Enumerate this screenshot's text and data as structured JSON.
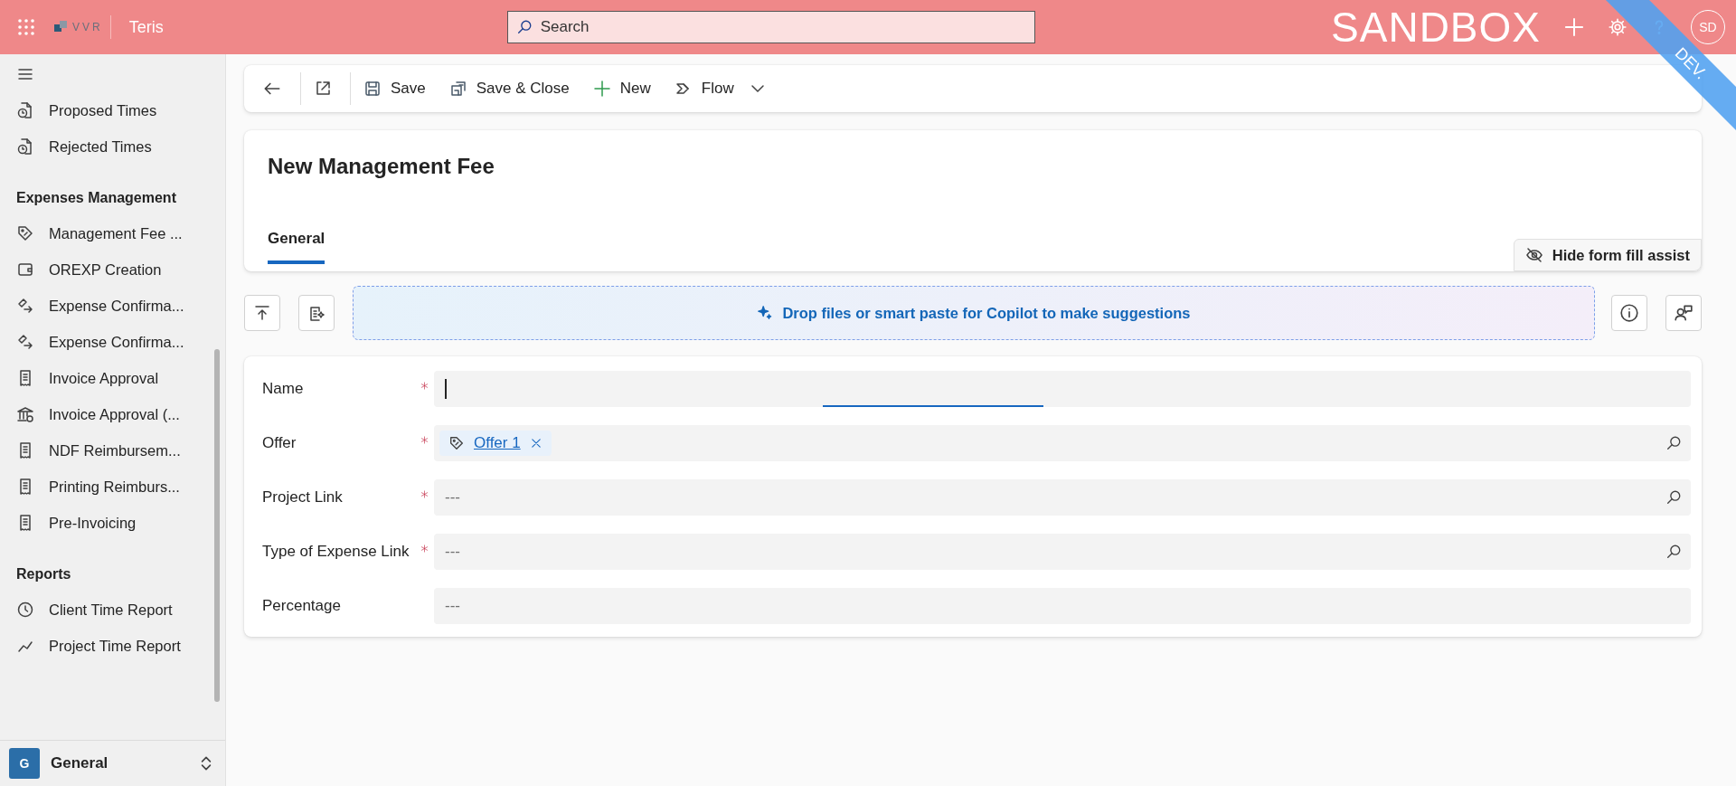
{
  "topbar": {
    "logo_text": "VVR",
    "app_name": "Teris",
    "search": {
      "placeholder": "Search"
    },
    "environment": "SANDBOX",
    "avatar": "SD",
    "ribbon": "DEV."
  },
  "sidebar": {
    "sections": [
      {
        "items": [
          {
            "label": "Proposed Times",
            "kind": "clock-doc"
          },
          {
            "label": "Rejected Times",
            "kind": "clock-doc"
          }
        ]
      },
      {
        "title": "Expenses Management",
        "items": [
          {
            "label": "Management Fee ...",
            "kind": "tag"
          },
          {
            "label": "OREXP Creation",
            "kind": "wallet"
          },
          {
            "label": "Expense Confirma...",
            "kind": "swap"
          },
          {
            "label": "Expense Confirma...",
            "kind": "swap"
          },
          {
            "label": "Invoice Approval",
            "kind": "doc"
          },
          {
            "label": "Invoice Approval (...",
            "kind": "bank"
          },
          {
            "label": "NDF Reimbursem...",
            "kind": "doc"
          },
          {
            "label": "Printing Reimburs...",
            "kind": "doc"
          },
          {
            "label": "Pre-Invoicing",
            "kind": "doc"
          }
        ]
      },
      {
        "title": "Reports",
        "items": [
          {
            "label": "Client Time Report",
            "kind": "clock"
          },
          {
            "label": "Project Time Report",
            "kind": "chart"
          }
        ]
      }
    ],
    "area": {
      "initial": "G",
      "label": "General"
    }
  },
  "toolbar": [
    {
      "kind": "back"
    },
    {
      "kind": "popout"
    },
    {
      "kind": "save",
      "label": "Save"
    },
    {
      "kind": "save-close",
      "label": "Save & Close"
    },
    {
      "kind": "new",
      "label": "New"
    },
    {
      "kind": "flow",
      "label": "Flow"
    }
  ],
  "form": {
    "title": "New Management Fee",
    "tabs": [
      {
        "label": "General",
        "selected": true
      }
    ],
    "assist_button": "Hide form fill assist",
    "copilot": {
      "prompt": "Drop files or smart paste for Copilot to make suggestions"
    },
    "fields": [
      {
        "label": "Name",
        "required": true,
        "kind": "text",
        "focused": true
      },
      {
        "label": "Offer",
        "required": true,
        "kind": "lookup",
        "tag": "Offer 1"
      },
      {
        "label": "Project Link",
        "required": true,
        "kind": "lookup",
        "placeholder": "---"
      },
      {
        "label": "Type of Expense Link",
        "required": true,
        "kind": "lookup",
        "placeholder": "---"
      },
      {
        "label": "Percentage",
        "required": false,
        "kind": "text",
        "placeholder": "---"
      }
    ]
  }
}
